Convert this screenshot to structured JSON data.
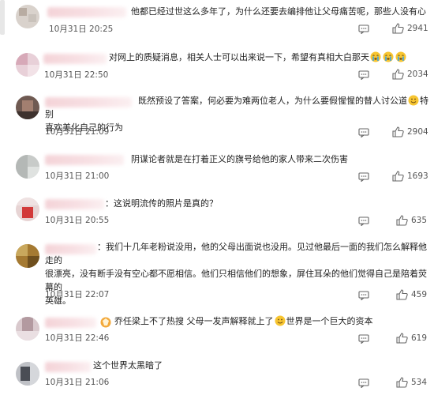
{
  "comments": [
    {
      "text": "他都已经过世这么多年了，为什么还要去编排他让父母痛苦呢，那些人没有心",
      "date": "10月31日 20:25",
      "likes": "2941"
    },
    {
      "text": "对网上的质疑消息，相关人士可以出来说一下，希望有真相大白那天",
      "date": "10月31日 22:50",
      "likes": "2034"
    },
    {
      "text": "既然预设了答案，何必要为难两位老人，为什么要假惺惺的替人讨公道",
      "text2": "特别",
      "text_cont": "喜欢美化自己的行为",
      "date": "10月31日 21:09",
      "likes": "2904"
    },
    {
      "text": "阴谋论者就是在打着正义的旗号给他的家人带来二次伤害",
      "date": "10月31日 21:00",
      "likes": "1693"
    },
    {
      "text": "：这说明流传的照片是真的？",
      "date": "10月31日 20:55",
      "likes": "635"
    },
    {
      "text": "：我们十几年老粉说没用，他的父母出面说也没用。见过他最后一面的我们怎么解释他走的",
      "text_cont": "很漂亮，没有断手没有空心都不愿相信。他们只相信他们的想象，屏住耳朵的他们觉得自己是陪着荧幕的",
      "text_cont2": "英雄。",
      "date": "10月31日 22:07",
      "likes": "459"
    },
    {
      "text": "乔任梁上不了热搜 父母一发声解释就上了",
      "text2": "世界是一个巨大的资本",
      "date": "10月31日 22:46",
      "likes": "619"
    },
    {
      "text": "这个世界太黑暗了",
      "date": "10月31日 21:06",
      "likes": "534"
    }
  ],
  "icons": {
    "reply": "comment-icon",
    "like": "thumbs-up-icon",
    "emoji_cry": "crying-face-icon",
    "emoji_smile": "smiling-face-icon"
  }
}
